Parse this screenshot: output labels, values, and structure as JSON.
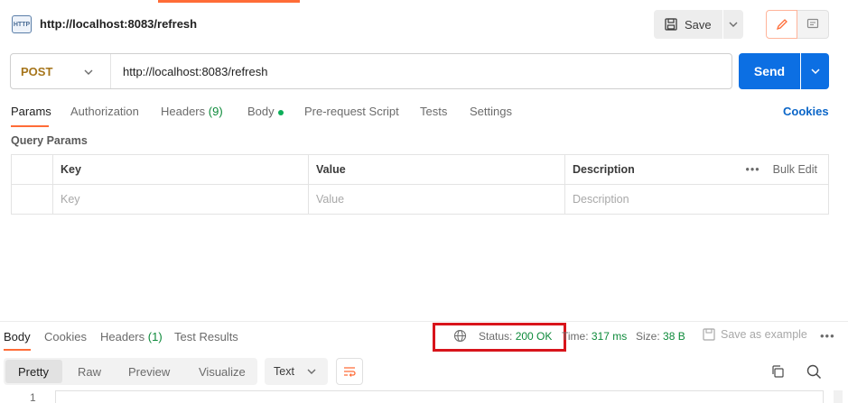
{
  "request": {
    "icon_label": "HTTP",
    "title": "http://localhost:8083/refresh",
    "method": "POST",
    "url": "http://localhost:8083/refresh"
  },
  "toolbar": {
    "save_label": "Save",
    "send_label": "Send"
  },
  "request_tabs": [
    {
      "label": "Params"
    },
    {
      "label": "Authorization"
    },
    {
      "label": "Headers",
      "count": "(9)"
    },
    {
      "label": "Body"
    },
    {
      "label": "Pre-request Script"
    },
    {
      "label": "Tests"
    },
    {
      "label": "Settings"
    }
  ],
  "cookies_link": "Cookies",
  "query_params": {
    "title": "Query Params",
    "columns": [
      "Key",
      "Value",
      "Description"
    ],
    "bulk_edit": "Bulk Edit",
    "placeholders": [
      "Key",
      "Value",
      "Description"
    ]
  },
  "response": {
    "tabs": [
      {
        "label": "Body"
      },
      {
        "label": "Cookies"
      },
      {
        "label": "Headers",
        "count": "(1)"
      },
      {
        "label": "Test Results"
      }
    ],
    "status_label": "Status:",
    "status_value": "200 OK",
    "time_label": "Time:",
    "time_value": "317 ms",
    "size_label": "Size:",
    "size_value": "38 B",
    "save_example": "Save as example",
    "view_modes": [
      "Pretty",
      "Raw",
      "Preview",
      "Visualize"
    ],
    "format": "Text",
    "line_number": "1"
  },
  "colors": {
    "accent": "#ff6c37",
    "send_blue": "#0c6fe3",
    "status_green": "#0d8a3a",
    "highlight_red": "#d8141b"
  }
}
